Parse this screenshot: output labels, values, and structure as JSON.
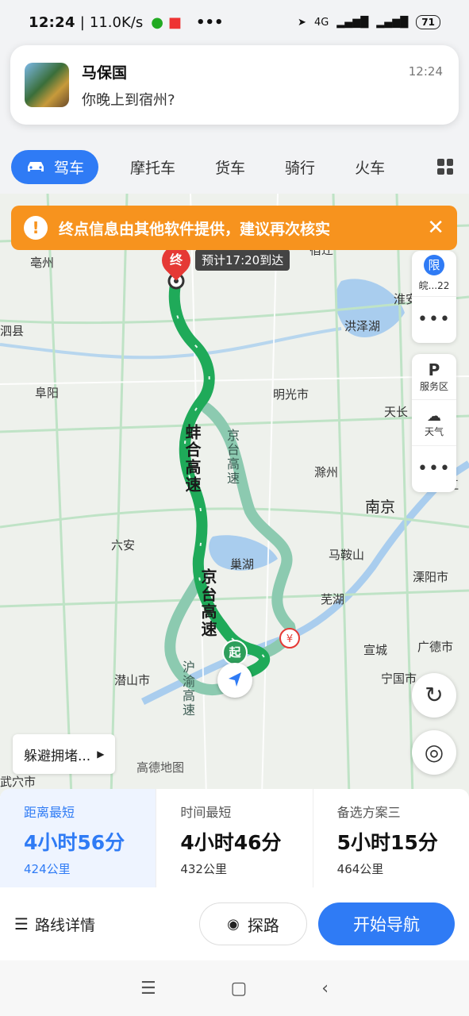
{
  "status_bar": {
    "time": "12:24",
    "speed": "11.0K/s",
    "dots": "•••",
    "network": "4G",
    "battery": "71"
  },
  "notification": {
    "sender": "马保国",
    "message": "你晚上到宿州?",
    "time": "12:24"
  },
  "transport_tabs": {
    "active": "驾车",
    "others": [
      "摩托车",
      "货车",
      "骑行",
      "火车"
    ]
  },
  "warning": {
    "text": "终点信息由其他软件提供，建议再次核实",
    "icon": "!",
    "close": "✕"
  },
  "map": {
    "end_marker": "终",
    "start_marker": "起",
    "eta": "预计17:20到达",
    "cities": [
      {
        "name": "亳州",
        "big": false
      },
      {
        "name": "淮安",
        "big": false
      },
      {
        "name": "洪泽湖",
        "big": false
      },
      {
        "name": "阜阳",
        "big": false
      },
      {
        "name": "明光市",
        "big": false
      },
      {
        "name": "天长",
        "big": false
      },
      {
        "name": "滁州",
        "big": false
      },
      {
        "name": "南京",
        "big": true
      },
      {
        "name": "六安",
        "big": false
      },
      {
        "name": "巢湖",
        "big": false
      },
      {
        "name": "马鞍山",
        "big": false
      },
      {
        "name": "芜湖",
        "big": false
      },
      {
        "name": "溧阳市",
        "big": false
      },
      {
        "name": "宣城",
        "big": false
      },
      {
        "name": "广德市",
        "big": false
      },
      {
        "name": "潜山市",
        "big": false
      },
      {
        "name": "宁国市",
        "big": false
      },
      {
        "name": "武穴市",
        "big": false
      },
      {
        "name": "泗县",
        "big": false
      },
      {
        "name": "镇江",
        "big": false
      },
      {
        "name": "宿迁",
        "big": false
      }
    ],
    "road_labels": {
      "main1": "蚌合高速",
      "main2": "京台高速",
      "alt1": "京台高速",
      "alt2": "沪渝高速"
    },
    "watermark": "高德地图"
  },
  "side_panel": {
    "limit_label": "限",
    "limit_text": "皖...22",
    "service_label": "服务区",
    "weather_label": "天气",
    "more": "•••"
  },
  "avoid_button": "躲避拥堵...",
  "routes": [
    {
      "tag": "距离最短",
      "time": "4小时56分",
      "distance": "424公里",
      "selected": true
    },
    {
      "tag": "时间最短",
      "time": "4小时46分",
      "distance": "432公里",
      "selected": false
    },
    {
      "tag": "备选方案三",
      "time": "5小时15分",
      "distance": "464公里",
      "selected": false
    }
  ],
  "actions": {
    "details": "路线详情",
    "probe": "探路",
    "navigate": "开始导航"
  },
  "colors": {
    "accent": "#2f7bf5",
    "route_main": "#1faa59",
    "route_alt": "#8ccab0",
    "warning": "#f7931e",
    "end_marker": "#e53935"
  }
}
